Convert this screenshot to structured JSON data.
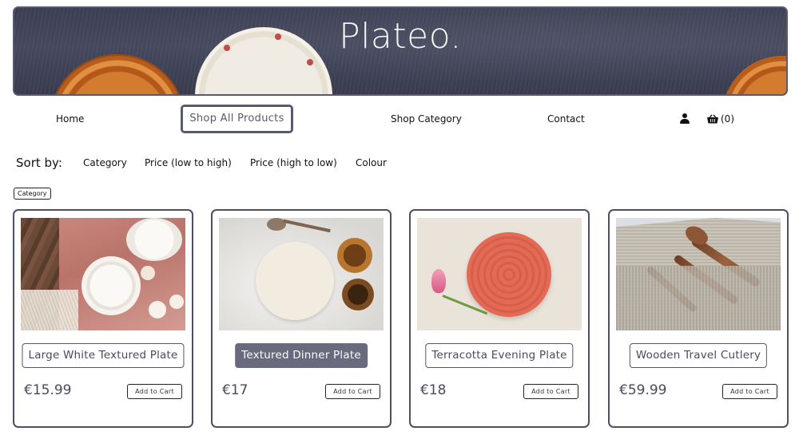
{
  "brand": {
    "name": "Plateo."
  },
  "nav": {
    "home": "Home",
    "shop_all": "Shop All Products",
    "shop_category": "Shop Category",
    "contact": "Contact",
    "cart_count": "(0)"
  },
  "sort": {
    "label": "Sort by:",
    "options": [
      "Category",
      "Price (low to high)",
      "Price (high to low)",
      "Colour"
    ],
    "active_filter": "Category"
  },
  "products": [
    {
      "name": "Large White Textured Plate",
      "price": "€15.99",
      "add_label": "Add to Cart"
    },
    {
      "name": "Textured Dinner Plate",
      "price": "€17",
      "add_label": "Add to Cart"
    },
    {
      "name": "Terracotta Evening Plate",
      "price": "€18",
      "add_label": "Add to Cart"
    },
    {
      "name": "Wooden Travel Cutlery",
      "price": "€59.99",
      "add_label": "Add to Cart"
    }
  ],
  "colors": {
    "accent": "#5a5a6e",
    "hover_button": "#6a6a7e",
    "banner": "#41445a"
  },
  "icons": {
    "user": "user-icon",
    "cart": "basket-icon"
  }
}
